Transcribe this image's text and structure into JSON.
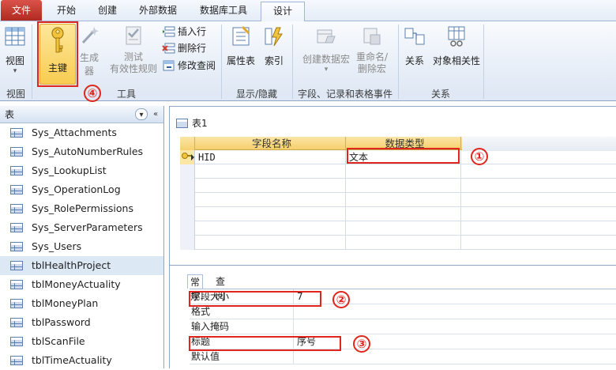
{
  "tabs": {
    "file": "文件",
    "home": "开始",
    "create": "创建",
    "external": "外部数据",
    "dbtools": "数据库工具",
    "design": "设计"
  },
  "ribbon": {
    "view": {
      "label": "视图",
      "group": "视图"
    },
    "tools": {
      "primary_key": "主键",
      "builder": "生成器",
      "test_rules_1": "测试",
      "test_rules_2": "有效性规则",
      "insert_rows": "插入行",
      "delete_rows": "删除行",
      "modify_lookups": "修改查阅",
      "group": "工具"
    },
    "show_hide": {
      "property_sheet": "属性表",
      "indexes": "索引",
      "group": "显示/隐藏"
    },
    "field_events": {
      "create_macro": "创建数据宏",
      "rename_macro_1": "重命名/",
      "rename_macro_2": "删除宏",
      "group": "字段、记录和表格事件"
    },
    "relationships": {
      "relationships": "关系",
      "object_dependencies": "对象相关性",
      "group": "关系"
    }
  },
  "nav": {
    "header": "表",
    "items": [
      "Sys_Attachments",
      "Sys_AutoNumberRules",
      "Sys_LookupList",
      "Sys_OperationLog",
      "Sys_RolePermissions",
      "Sys_ServerParameters",
      "Sys_Users",
      "tblHealthProject",
      "tblMoneyActuality",
      "tblMoneyPlan",
      "tblPassword",
      "tblScanFile",
      "tblTimeActuality"
    ],
    "selected_index": 7
  },
  "doc": {
    "title": "表1",
    "grid": {
      "col_field": "字段名称",
      "col_type": "数据类型",
      "rows": [
        {
          "field": "HID",
          "type": "文本"
        }
      ]
    },
    "props": {
      "tab_general": "常规",
      "tab_lookup": "查阅",
      "rows": [
        {
          "label": "字段大小",
          "value": "7"
        },
        {
          "label": "格式",
          "value": ""
        },
        {
          "label": "输入掩码",
          "value": ""
        },
        {
          "label": "标题",
          "value": "序号"
        },
        {
          "label": "默认值",
          "value": ""
        }
      ]
    }
  },
  "annotations": [
    "①",
    "②",
    "③",
    "④"
  ],
  "colors": {
    "file_tab": "#c2392f",
    "highlight": "#e0261c",
    "header_gold": "#f6cf6d"
  }
}
